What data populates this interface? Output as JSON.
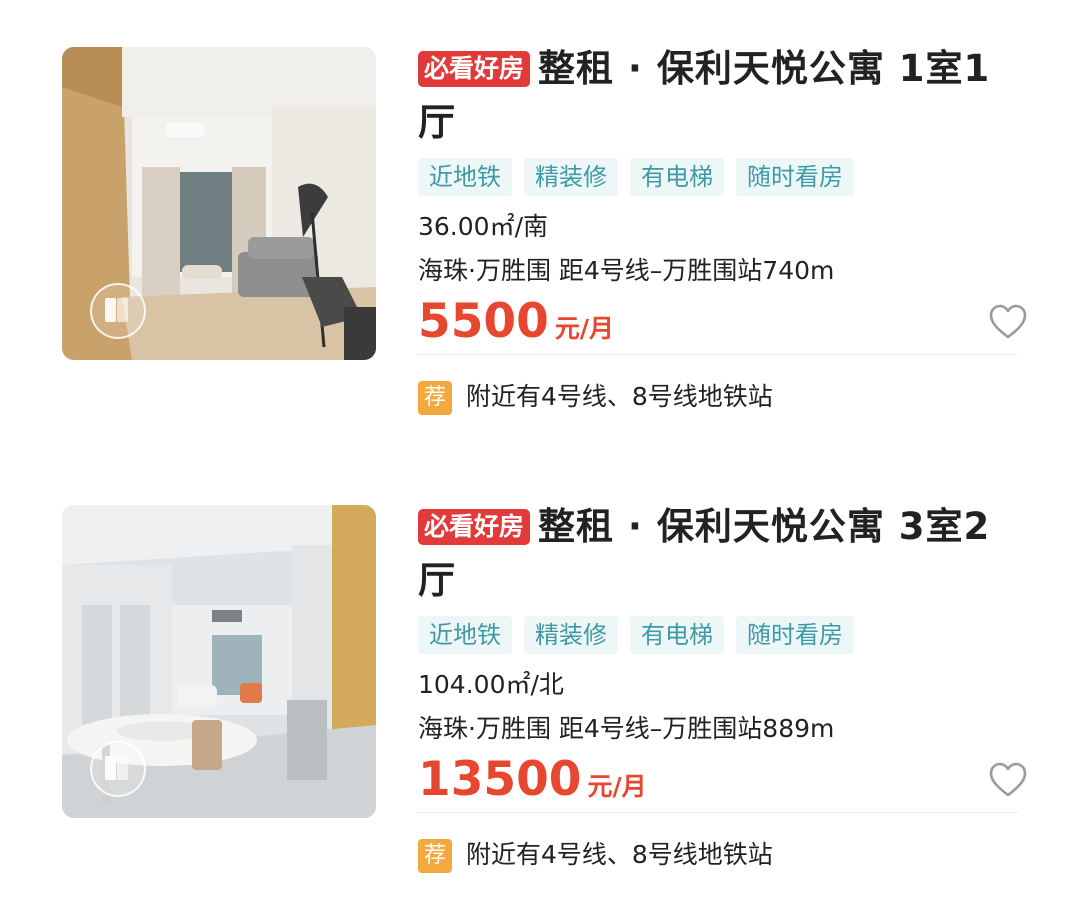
{
  "listings": [
    {
      "badge": "必看好房",
      "title": "整租 · 保利天悦公寓 1室1厅",
      "tags": [
        "近地铁",
        "精装修",
        "有电梯",
        "随时看房"
      ],
      "area_orientation": "36.00㎡/南",
      "location": "海珠·万胜围 距4号线–万胜围站740m",
      "price": "5500",
      "price_unit": "元/月",
      "recommend_badge": "荐",
      "recommend_text": "附近有4号线、8号线地铁站",
      "favorited": false
    },
    {
      "badge": "必看好房",
      "title": "整租 · 保利天悦公寓 3室2厅",
      "tags": [
        "近地铁",
        "精装修",
        "有电梯",
        "随时看房"
      ],
      "area_orientation": "104.00㎡/北",
      "location": "海珠·万胜围 距4号线–万胜围站889m",
      "price": "13500",
      "price_unit": "元/月",
      "recommend_badge": "荐",
      "recommend_text": "附近有4号线、8号线地铁站",
      "favorited": false
    }
  ],
  "colors": {
    "badge": "#e13a3a",
    "price": "#e8472f",
    "tag_text": "#3e9aa6",
    "tag_bg": "#eef7f8",
    "recommend": "#f3a940"
  },
  "icons": {
    "favorite": "heart-outline-icon",
    "vr": "vr-tour-icon"
  }
}
